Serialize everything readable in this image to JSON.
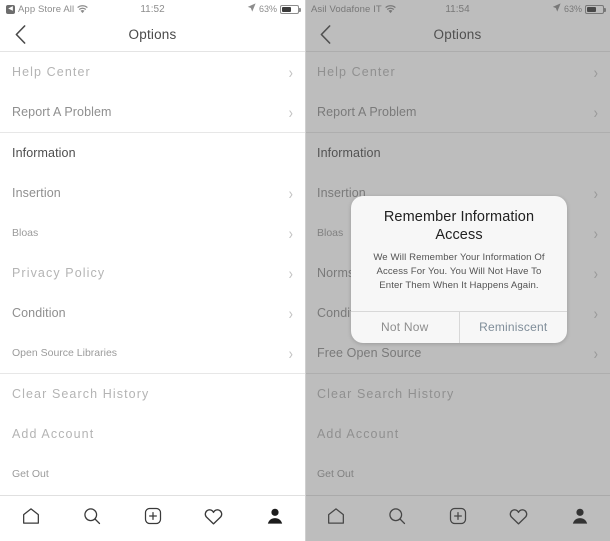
{
  "left_panel": {
    "status_bar": {
      "back_app": "App Store All",
      "wifi_icon": "wifi-icon",
      "time": "11:52",
      "location_icon": "location-arrow-icon",
      "battery_percent": "63%",
      "battery_icon": "battery-icon"
    },
    "nav": {
      "back_icon": "chevron-left-icon",
      "title": "Options"
    },
    "rows": [
      {
        "label": "Help Center",
        "chevron": true,
        "style": "blurry"
      },
      {
        "label": "Report A Problem",
        "chevron": true,
        "style": "normal"
      },
      {
        "separator": true
      },
      {
        "label": "Information",
        "chevron": false,
        "style": "header"
      },
      {
        "label": "Insertion",
        "chevron": true,
        "style": "normal"
      },
      {
        "label": "Bloas",
        "chevron": true,
        "style": "small"
      },
      {
        "label": "Privacy Policy",
        "chevron": true,
        "style": "blurry"
      },
      {
        "label": "Condition",
        "chevron": true,
        "style": "normal"
      },
      {
        "label": "Open Source Libraries",
        "chevron": true,
        "style": "small"
      },
      {
        "separator": true
      },
      {
        "label": "Clear Search History",
        "chevron": false,
        "style": "blurry"
      },
      {
        "label": "Add Account",
        "chevron": false,
        "style": "blurry"
      },
      {
        "label": "Get Out",
        "chevron": false,
        "style": "small"
      }
    ],
    "tabs": [
      {
        "icon": "home-icon",
        "name": "tab-home"
      },
      {
        "icon": "search-icon",
        "name": "tab-search"
      },
      {
        "icon": "add-icon",
        "name": "tab-add"
      },
      {
        "icon": "heart-icon",
        "name": "tab-activity"
      },
      {
        "icon": "profile-icon",
        "name": "tab-profile"
      }
    ]
  },
  "right_panel": {
    "status_bar": {
      "carrier": "Asil Vodafone IT",
      "wifi_icon": "wifi-icon",
      "time": "11:54",
      "location_icon": "location-arrow-icon",
      "battery_percent": "63%",
      "battery_icon": "battery-icon"
    },
    "nav": {
      "back_icon": "chevron-left-icon",
      "title": "Options"
    },
    "rows": [
      {
        "label": "Help Center",
        "chevron": true,
        "style": "blurry"
      },
      {
        "label": "Report A Problem",
        "chevron": true,
        "style": "normal"
      },
      {
        "separator": true
      },
      {
        "label": "Information",
        "chevron": false,
        "style": "header"
      },
      {
        "label": "Insertion",
        "chevron": true,
        "style": "normal"
      },
      {
        "label": "Bloas",
        "chevron": true,
        "style": "small"
      },
      {
        "label": "Norms",
        "chevron": true,
        "style": "normal"
      },
      {
        "label": "Conditions",
        "chevron": true,
        "style": "normal"
      },
      {
        "label": "Free Open Source",
        "chevron": true,
        "style": "normal"
      },
      {
        "separator": true
      },
      {
        "label": "Clear Search History",
        "chevron": false,
        "style": "blurry"
      },
      {
        "label": "Add Account",
        "chevron": false,
        "style": "blurry"
      },
      {
        "label": "Get Out",
        "chevron": false,
        "style": "small"
      }
    ],
    "tabs": [
      {
        "icon": "home-icon",
        "name": "tab-home"
      },
      {
        "icon": "search-icon",
        "name": "tab-search"
      },
      {
        "icon": "add-icon",
        "name": "tab-add"
      },
      {
        "icon": "heart-icon",
        "name": "tab-activity"
      },
      {
        "icon": "profile-icon",
        "name": "tab-profile"
      }
    ],
    "modal": {
      "title": "Remember Information Access",
      "message": "We Will Remember Your Information Of Access For You. You Will Not Have To Enter Them When It Happens Again.",
      "cancel_label": "Not Now",
      "confirm_label": "Reminiscent"
    }
  },
  "colors": {
    "overlay": "#5a5a5a",
    "modal_bg": "#f7f7f7",
    "text_muted": "#8f8f8f",
    "separator": "#e7e7e7",
    "confirm_text": "#7f8d99"
  }
}
